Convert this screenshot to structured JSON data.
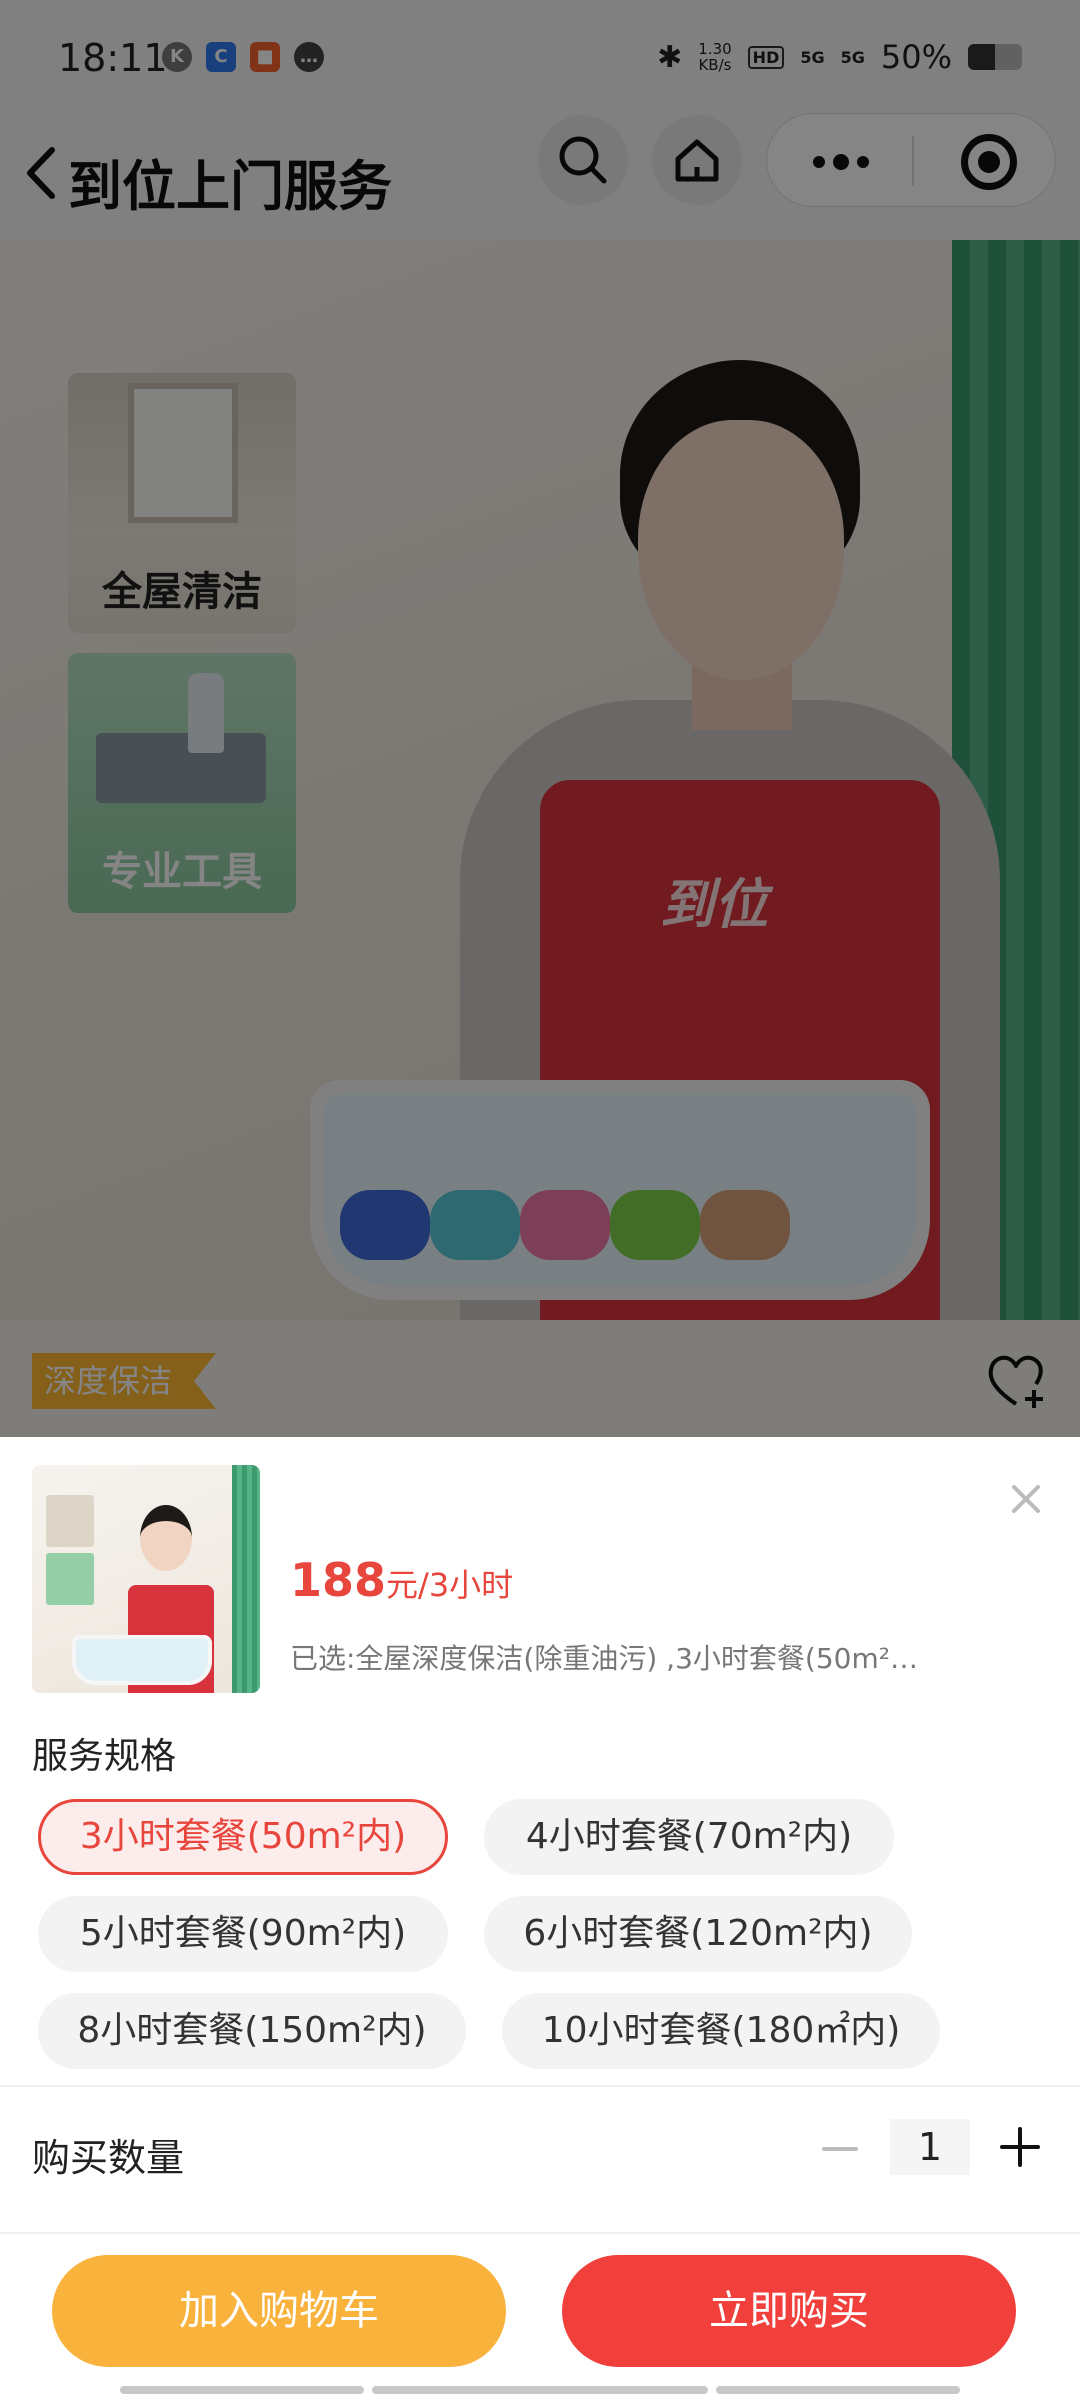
{
  "status_bar": {
    "time": "18:11",
    "network_speed": "1.30\nKB/s",
    "network_badge": "HD",
    "signal_1": "5G",
    "signal_2": "5G",
    "battery": "50%",
    "battery_level": 0.5
  },
  "nav": {
    "title": "到位上门服务",
    "search_icon": "search-icon",
    "home_icon": "home-icon",
    "more_icon": "more-dots-icon",
    "close_icon": "target-icon"
  },
  "hero": {
    "chip_1": "全屋清洁",
    "chip_2": "专业工具",
    "apron_logo": "到位"
  },
  "product": {
    "tag": "深度保洁",
    "favorite_icon": "heart-plus-icon"
  },
  "sheet": {
    "price": "188",
    "price_unit": "元/3小时",
    "selected": "已选:全屋深度保洁(除重油污) ,3小时套餐(50m²…",
    "spec_heading": "服务规格",
    "options": [
      {
        "label": "3小时套餐(50m²内)",
        "selected": true
      },
      {
        "label": "4小时套餐(70m²内)",
        "selected": false
      },
      {
        "label": "5小时套餐(90m²内)",
        "selected": false
      },
      {
        "label": "6小时套餐(120m²内)",
        "selected": false
      },
      {
        "label": "8小时套餐(150m²内)",
        "selected": false
      },
      {
        "label": "10小时套餐(180㎡内)",
        "selected": false
      }
    ],
    "quantity_label": "购买数量",
    "quantity": "1",
    "add_to_cart": "加入购物车",
    "buy_now": "立即购买"
  },
  "colors": {
    "accent": "#e8453c",
    "cart_button": "#f9b23c",
    "buy_button": "#f1403c",
    "tag": "#ffb833"
  }
}
